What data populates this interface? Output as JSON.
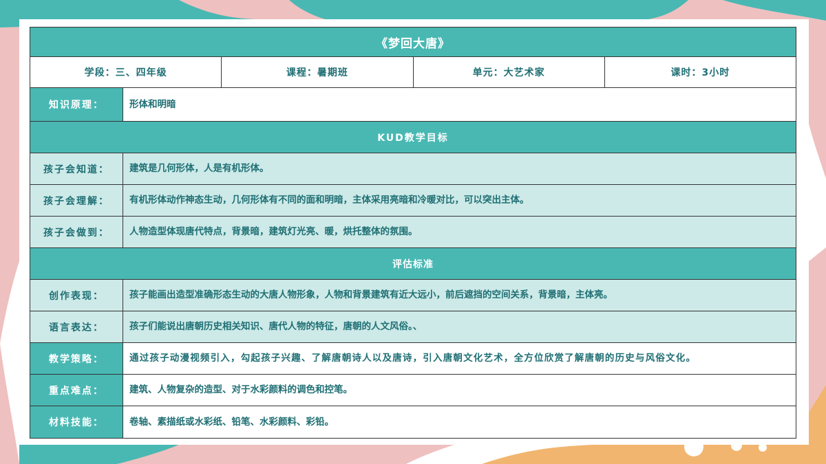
{
  "header": {
    "title": "《梦回大唐》"
  },
  "info": [
    {
      "label": "学段：三、四年级"
    },
    {
      "label": "课程：暑期班"
    },
    {
      "label": "单元：大艺术家"
    },
    {
      "label": "课时：3小时"
    }
  ],
  "knowledge": {
    "label": "知识原理：",
    "value": "形体和明暗"
  },
  "kud": {
    "heading": "KUD教学目标",
    "rows": [
      {
        "label": "孩子会知道：",
        "value": "建筑是几何形体，人是有机形体。"
      },
      {
        "label": "孩子会理解：",
        "value": "有机形体动作神态生动，几何形体有不同的面和明暗，主体采用亮暗和冷暖对比，可以突出主体。"
      },
      {
        "label": "孩子会做到：",
        "value": "人物造型体现唐代特点，背景暗，建筑灯光亮、暖，烘托整体的氛围。"
      }
    ]
  },
  "evaluation": {
    "heading": "评估标准",
    "rows": [
      {
        "label": "创作表现：",
        "value": "孩子能画出造型准确形态生动的大唐人物形象，人物和背景建筑有近大远小，前后遮挡的空间关系，背景暗，主体亮。"
      },
      {
        "label": "语言表达：",
        "value": "孩子们能说出唐朝历史相关知识、唐代人物的特征，唐朝的人文风俗。、"
      }
    ]
  },
  "extra": [
    {
      "label": "教学策略：",
      "value": "通过孩子动漫视频引入，勾起孩子兴趣、了解唐朝诗人以及唐诗，引入唐朝文化艺术，全方位欣赏了解唐朝的历史与风俗文化。"
    },
    {
      "label": "重点难点：",
      "value": "建筑、人物复杂的造型、对于水彩颜料的调色和控笔。"
    },
    {
      "label": "材料技能：",
      "value": "卷轴、素描纸或水彩纸、铅笔、水彩颜料、彩铅。"
    }
  ],
  "colors": {
    "teal": "#49b8b3",
    "light_teal": "#cdeae8",
    "text_teal": "#1f6f74",
    "pink": "#efc0c0",
    "orange": "#f2b56f"
  }
}
